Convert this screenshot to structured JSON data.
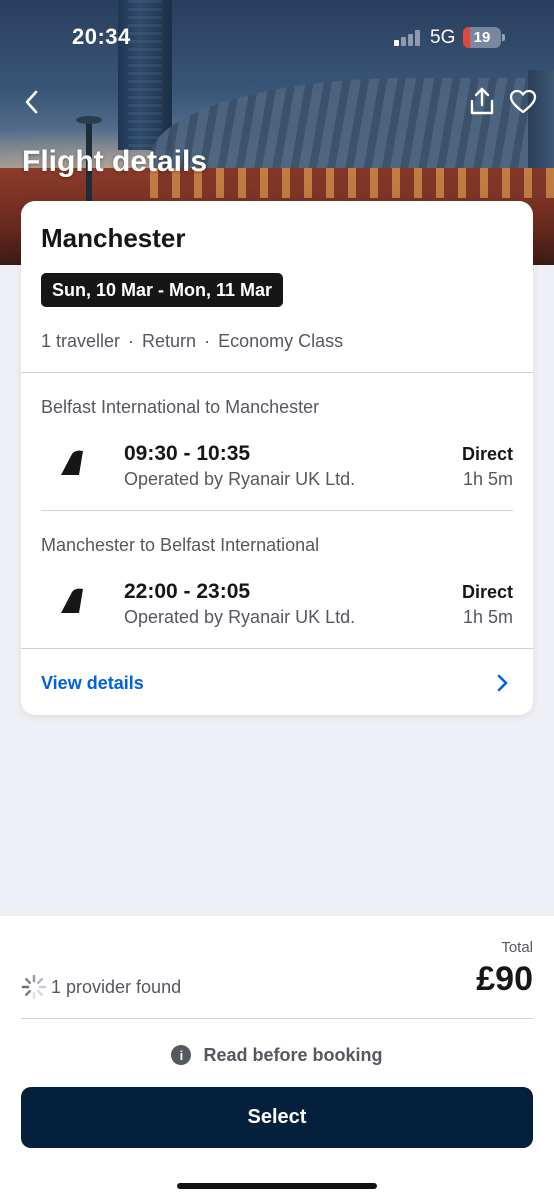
{
  "status_bar": {
    "time": "20:34",
    "network": "5G",
    "battery": "19",
    "battery_level_percent": 19,
    "signal_bars_active": 1,
    "signal_bars_total": 4
  },
  "header": {
    "title": "Flight details",
    "back_icon": "chevron-left-icon",
    "share_icon": "share-icon",
    "favorite_icon": "heart-icon"
  },
  "trip": {
    "destination": "Manchester",
    "dates": "Sun, 10 Mar - Mon, 11 Mar",
    "travellers": "1 traveller",
    "trip_type": "Return",
    "cabin_class": "Economy Class",
    "separator": "·"
  },
  "legs": [
    {
      "route": "Belfast International to Manchester",
      "times": "09:30 - 10:35",
      "operator": "Operated by Ryanair UK Ltd.",
      "stops": "Direct",
      "duration": "1h 5m",
      "airline_icon": "ryanair-tail-icon"
    },
    {
      "route": "Manchester to Belfast International",
      "times": "22:00 - 23:05",
      "operator": "Operated by Ryanair UK Ltd.",
      "stops": "Direct",
      "duration": "1h 5m",
      "airline_icon": "ryanair-tail-icon"
    }
  ],
  "view_details": {
    "label": "View details",
    "icon": "chevron-right-icon"
  },
  "footer": {
    "total_label": "Total",
    "price": "£90",
    "providers": "1 provider found",
    "read_before_booking": "Read before booking",
    "select_label": "Select"
  },
  "colors": {
    "accent_link": "#0062e3",
    "primary_button": "#05203c",
    "battery_low": "#e5453b",
    "badge_bg": "#161616"
  }
}
